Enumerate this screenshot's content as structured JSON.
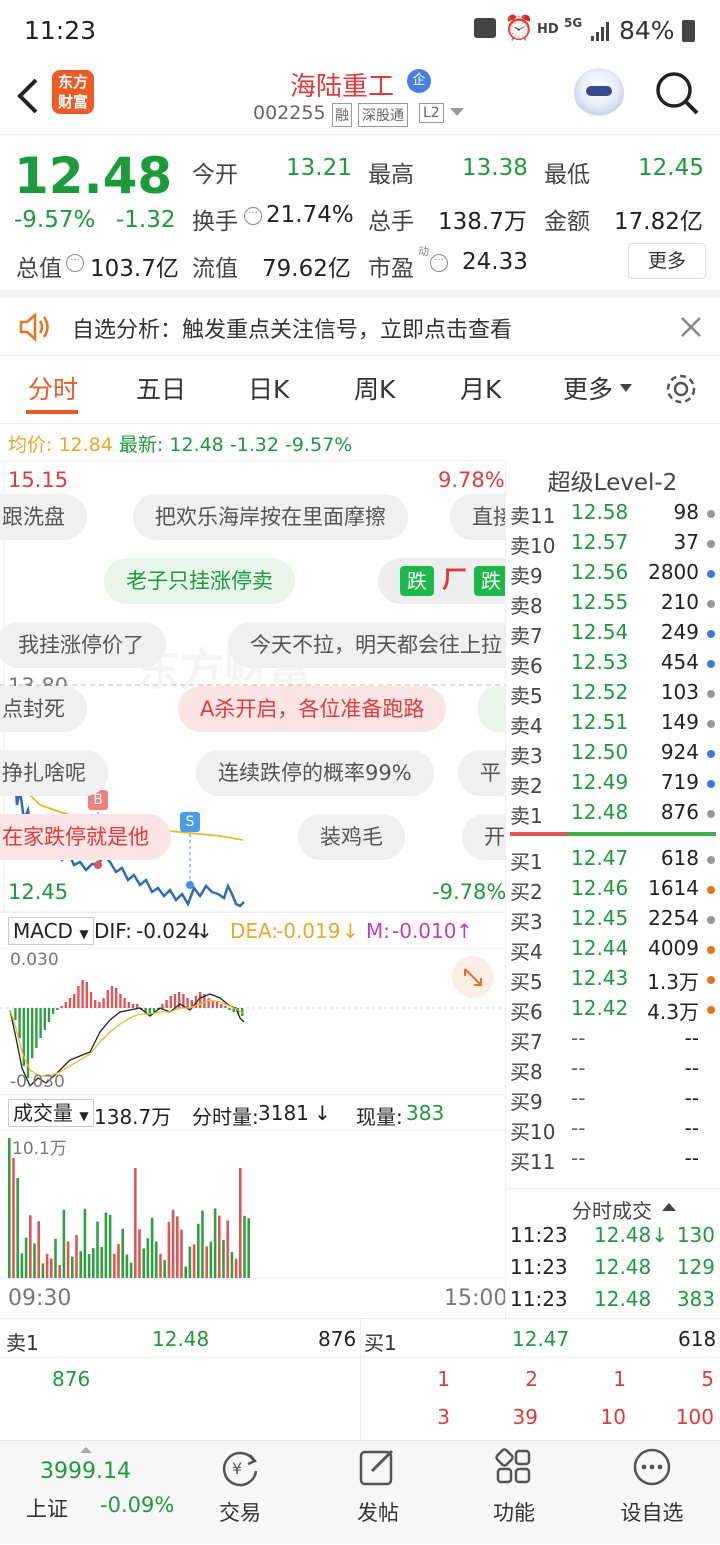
{
  "status": {
    "time": "11:23",
    "hd": "HD",
    "net": "5G",
    "battery": "84%"
  },
  "header": {
    "brand_line1": "东方",
    "brand_line2": "财富",
    "stock_name": "海陆重工",
    "ent_badge": "企",
    "code": "002255",
    "tag_margin": "融",
    "tag_connect": "深股通",
    "tag_level": "L2"
  },
  "quote": {
    "price": "12.48",
    "pct": "-9.57%",
    "chg": "-1.32",
    "open_label": "今开",
    "open": "13.21",
    "high_label": "最高",
    "high": "13.38",
    "low_label": "最低",
    "low": "12.45",
    "turnover_label": "换手",
    "turnover": "21.74%",
    "volume_label": "总手",
    "volume": "138.7万",
    "amount_label": "金额",
    "amount": "17.82亿",
    "mktcap_label": "总值",
    "mktcap": "103.7亿",
    "float_label": "流值",
    "float": "79.62亿",
    "pe_label": "市盈",
    "pe_sup": "动",
    "pe": "24.33",
    "more": "更多"
  },
  "notice": {
    "text": "自选分析：触发重点关注信号，立即点击查看"
  },
  "tabs": {
    "t1": "分时",
    "t2": "五日",
    "t3": "日K",
    "t4": "周K",
    "t5": "月K",
    "t6": "更多"
  },
  "intraday": {
    "avg_label": "均价:",
    "avg": "12.84",
    "last_label": "最新:",
    "last": "12.48",
    "last_chg": "-1.32",
    "last_pct": "-9.57%",
    "top_price": "15.15",
    "top_pct": "9.78%",
    "mid_price": "13.80",
    "bot_price": "12.45",
    "bot_pct": "-9.78%",
    "marker_b": "B",
    "marker_s": "S",
    "watermark": "东方财富"
  },
  "danmu": {
    "d1": "跟洗盘",
    "d2": "把欢乐海岸按在里面摩擦",
    "d3": "直接",
    "d4": "老子只挂涨停卖",
    "d5": "我挂涨停价了",
    "d6": "今天不拉，明天都会往上拉",
    "d7": "点封死",
    "d8": "A杀开启，各位准备跑路",
    "d9": "挣扎啥呢",
    "d10": "连续跌停的概率99%",
    "d11": "平",
    "d12": "在家跌停就是他",
    "d13": "装鸡毛",
    "d14": "开",
    "die1": "跌",
    "die2": "跌"
  },
  "macd": {
    "name": "MACD",
    "dif_label": "DIF:",
    "dif": "-0.024",
    "dea_label": "DEA:",
    "dea": "-0.019",
    "m_label": "M:",
    "m": "-0.010",
    "ymax": "0.030",
    "ymin": "-0.030"
  },
  "volume": {
    "name": "成交量",
    "total": "138.7万",
    "fs_label": "分时量:",
    "fs": "3181",
    "now_label": "现量:",
    "now": "383",
    "ymax": "10.1万",
    "t_start": "09:30",
    "t_end": "15:00"
  },
  "book": {
    "title": "超级Level-2",
    "sells": [
      {
        "l": "卖11",
        "p": "12.58",
        "v": "98",
        "c": "#999"
      },
      {
        "l": "卖10",
        "p": "12.57",
        "v": "37",
        "c": "#999"
      },
      {
        "l": "卖9",
        "p": "12.56",
        "v": "2800",
        "c": "#3a7bd5"
      },
      {
        "l": "卖8",
        "p": "12.55",
        "v": "210",
        "c": "#999"
      },
      {
        "l": "卖7",
        "p": "12.54",
        "v": "249",
        "c": "#3a7bd5"
      },
      {
        "l": "卖6",
        "p": "12.53",
        "v": "454",
        "c": "#3a7bd5"
      },
      {
        "l": "卖5",
        "p": "12.52",
        "v": "103",
        "c": "#999"
      },
      {
        "l": "卖4",
        "p": "12.51",
        "v": "149",
        "c": "#999"
      },
      {
        "l": "卖3",
        "p": "12.50",
        "v": "924",
        "c": "#3a7bd5"
      },
      {
        "l": "卖2",
        "p": "12.49",
        "v": "719",
        "c": "#3a7bd5"
      },
      {
        "l": "卖1",
        "p": "12.48",
        "v": "876",
        "c": "#999"
      }
    ],
    "buys": [
      {
        "l": "买1",
        "p": "12.47",
        "v": "618",
        "c": "#999"
      },
      {
        "l": "买2",
        "p": "12.46",
        "v": "1614",
        "c": "#e8731e"
      },
      {
        "l": "买3",
        "p": "12.45",
        "v": "2254",
        "c": "#999"
      },
      {
        "l": "买4",
        "p": "12.44",
        "v": "4009",
        "c": "#e8731e"
      },
      {
        "l": "买5",
        "p": "12.43",
        "v": "1.3万",
        "c": "#e8731e"
      },
      {
        "l": "买6",
        "p": "12.42",
        "v": "4.3万",
        "c": "#e8731e"
      },
      {
        "l": "买7",
        "p": "--",
        "v": "--",
        "c": ""
      },
      {
        "l": "买8",
        "p": "--",
        "v": "--",
        "c": ""
      },
      {
        "l": "买9",
        "p": "--",
        "v": "--",
        "c": ""
      },
      {
        "l": "买10",
        "p": "--",
        "v": "--",
        "c": ""
      },
      {
        "l": "买11",
        "p": "--",
        "v": "--",
        "c": ""
      }
    ],
    "trades_title": "分时成交",
    "trades": [
      {
        "t": "11:23",
        "p": "12.48↓",
        "v": "130"
      },
      {
        "t": "11:23",
        "p": "12.48",
        "v": "129"
      },
      {
        "t": "11:23",
        "p": "12.48",
        "v": "383"
      }
    ]
  },
  "queue": {
    "sell_label": "卖1",
    "sell_price": "12.48",
    "sell_vol": "876",
    "sell_orders": [
      "876"
    ],
    "buy_label": "买1",
    "buy_price": "12.47",
    "buy_vol": "618",
    "buy_orders": [
      "1",
      "2",
      "1",
      "5",
      "3",
      "39",
      "10",
      "100"
    ]
  },
  "nav": {
    "index_value": "3999.14",
    "index_name": "上证",
    "index_pct": "-0.09%",
    "trade": "交易",
    "post": "发帖",
    "func": "功能",
    "watch": "设自选"
  }
}
